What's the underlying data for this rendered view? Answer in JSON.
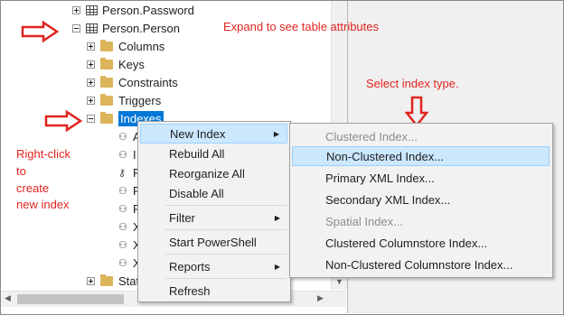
{
  "tree": {
    "items": [
      {
        "label": "Person.Password"
      },
      {
        "label": "Person.Person"
      },
      {
        "label": "Columns"
      },
      {
        "label": "Keys"
      },
      {
        "label": "Constraints"
      },
      {
        "label": "Triggers"
      },
      {
        "label": "Indexes"
      }
    ],
    "index_partials": [
      "A",
      "I",
      "P",
      "P",
      "P",
      "X",
      "X",
      "X"
    ],
    "statistics_partial": "Stat"
  },
  "annotations": {
    "expand": "Expand to see table attributes",
    "select_type": "Select index type.",
    "right_click": [
      "Right-click",
      "to",
      "create",
      "new index"
    ]
  },
  "context_menu": {
    "items": [
      {
        "label": "New Index",
        "has_submenu": true
      },
      {
        "label": "Rebuild All"
      },
      {
        "label": "Reorganize All"
      },
      {
        "label": "Disable All"
      },
      {
        "label": "Filter",
        "has_submenu": true
      },
      {
        "label": "Start PowerShell"
      },
      {
        "label": "Reports",
        "has_submenu": true
      },
      {
        "label": "Refresh"
      }
    ]
  },
  "submenu": {
    "items": [
      {
        "label": "Clustered Index...",
        "disabled": true
      },
      {
        "label": "Non-Clustered Index...",
        "highlighted": true
      },
      {
        "label": "Primary XML Index..."
      },
      {
        "label": "Secondary XML Index..."
      },
      {
        "label": "Spatial Index...",
        "disabled": true
      },
      {
        "label": "Clustered Columnstore Index..."
      },
      {
        "label": "Non-Clustered Columnstore Index..."
      }
    ]
  },
  "colors": {
    "annotation": "#e0241f",
    "selection": "#0078d7",
    "menu_highlight": "#cce8ff"
  },
  "icons": {
    "submenu_arrow": "triangle-right",
    "expand": "plus-box",
    "collapse": "minus-box",
    "index": "index-tree-icon",
    "key": "key-icon"
  }
}
